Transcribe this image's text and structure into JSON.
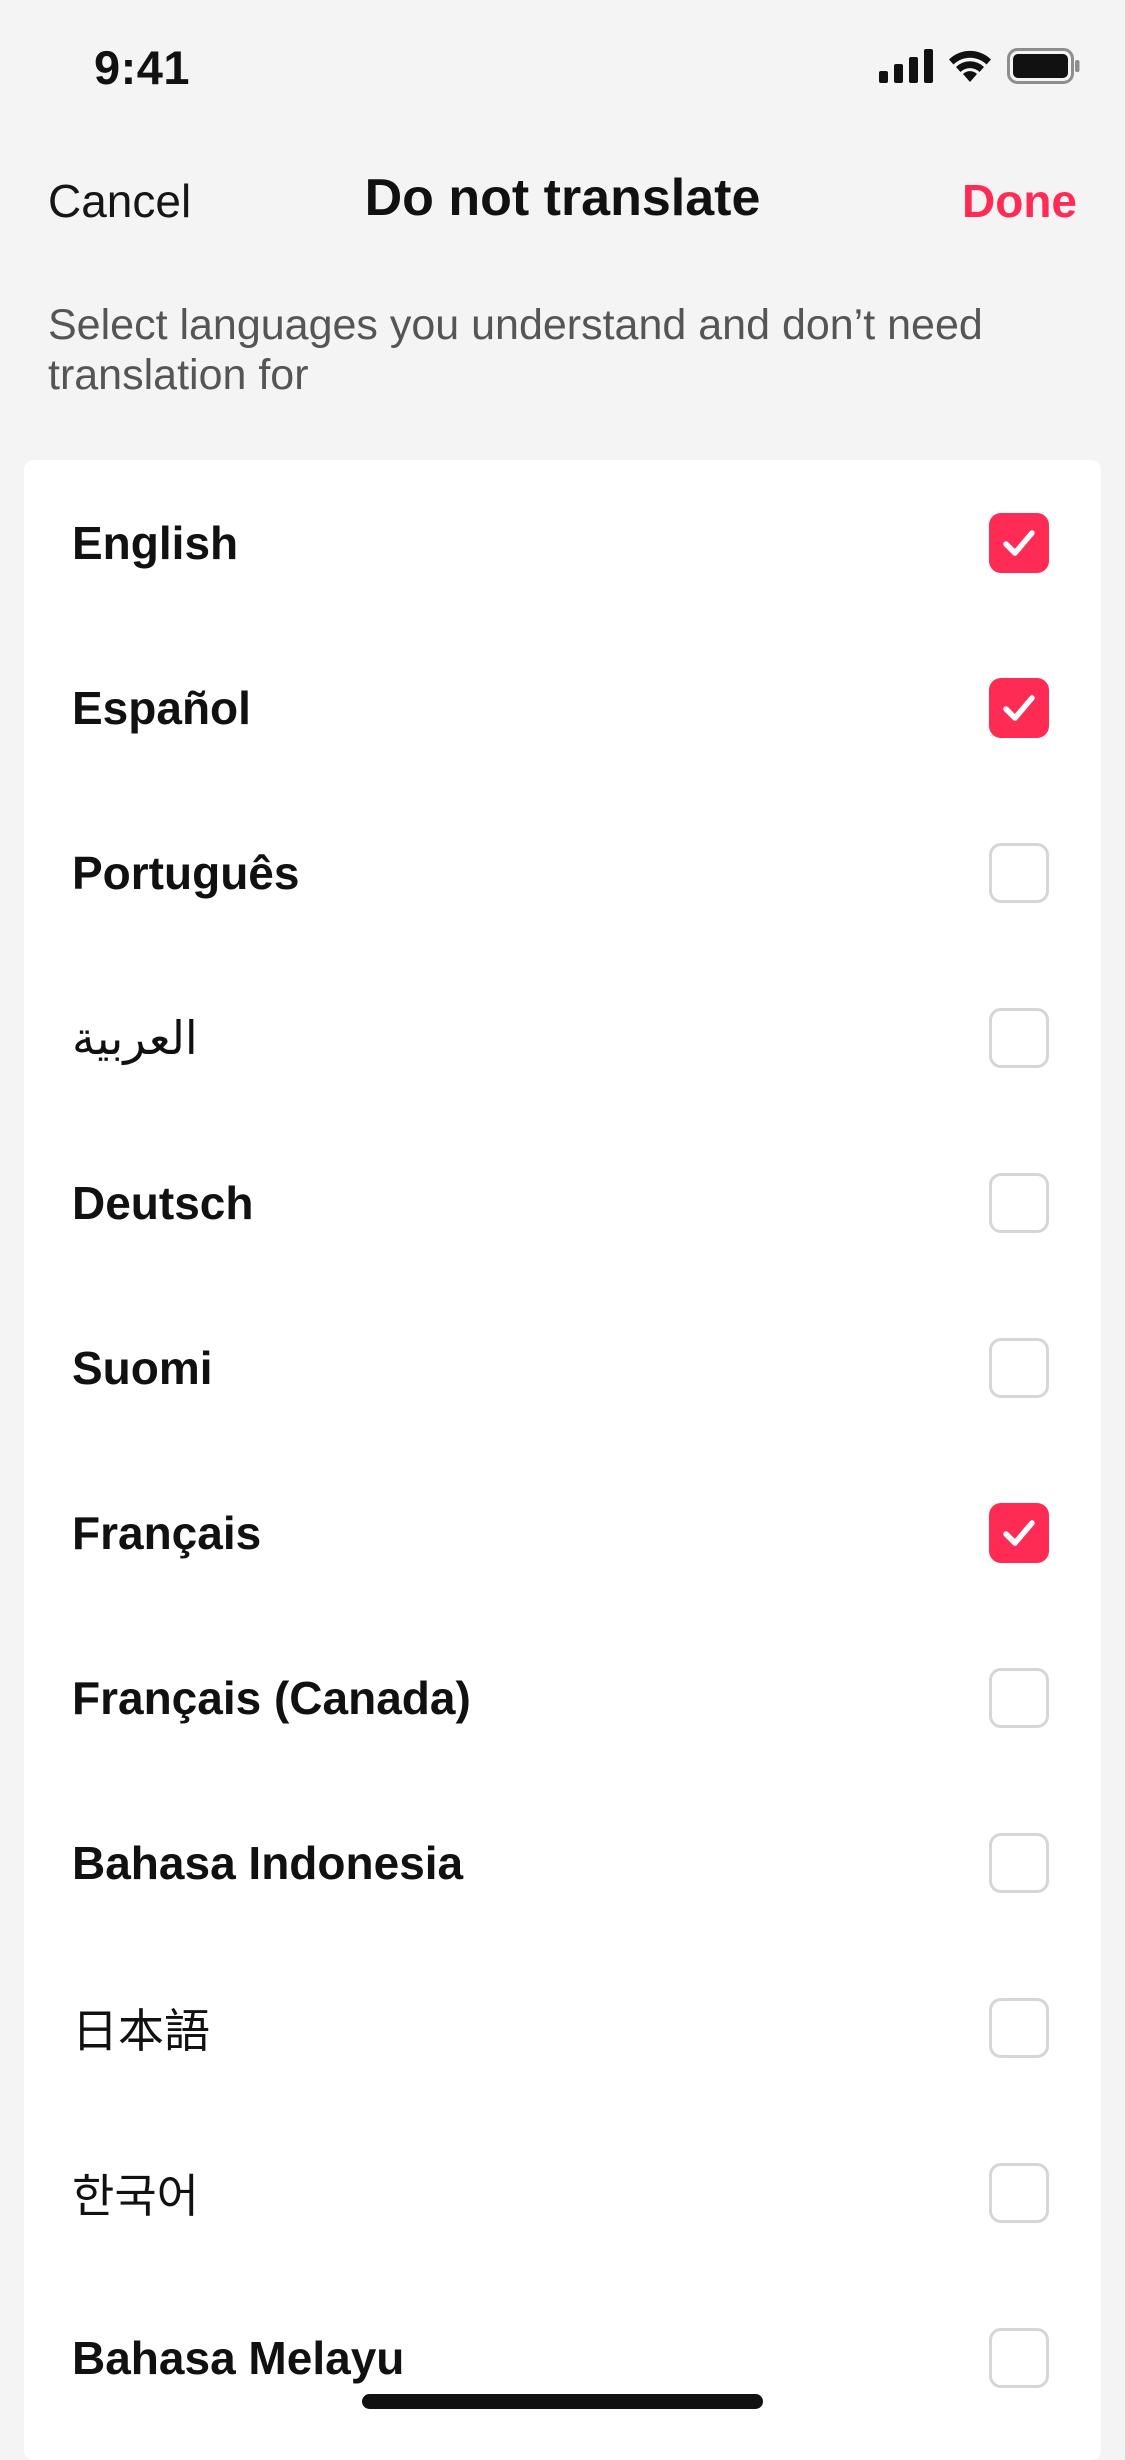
{
  "status_bar": {
    "time": "9:41",
    "icons": [
      "cellular-signal-icon",
      "wifi-icon",
      "battery-icon"
    ]
  },
  "nav": {
    "cancel_label": "Cancel",
    "title": "Do not translate",
    "done_label": "Done"
  },
  "description": "Select languages you understand and don’t need translation for",
  "colors": {
    "accent": "#fe2c55",
    "background": "#f4f4f4",
    "card": "#ffffff",
    "checkbox_border": "#d6d6d6"
  },
  "languages": [
    {
      "label": "English",
      "checked": true
    },
    {
      "label": "Español",
      "checked": true
    },
    {
      "label": "Português",
      "checked": false
    },
    {
      "label": "العربية",
      "checked": false
    },
    {
      "label": "Deutsch",
      "checked": false
    },
    {
      "label": "Suomi",
      "checked": false
    },
    {
      "label": "Français",
      "checked": true
    },
    {
      "label": "Français (Canada)",
      "checked": false
    },
    {
      "label": "Bahasa Indonesia",
      "checked": false
    },
    {
      "label": "日本語",
      "checked": false
    },
    {
      "label": "한국어",
      "checked": false
    },
    {
      "label": "Bahasa Melayu",
      "checked": false
    }
  ]
}
